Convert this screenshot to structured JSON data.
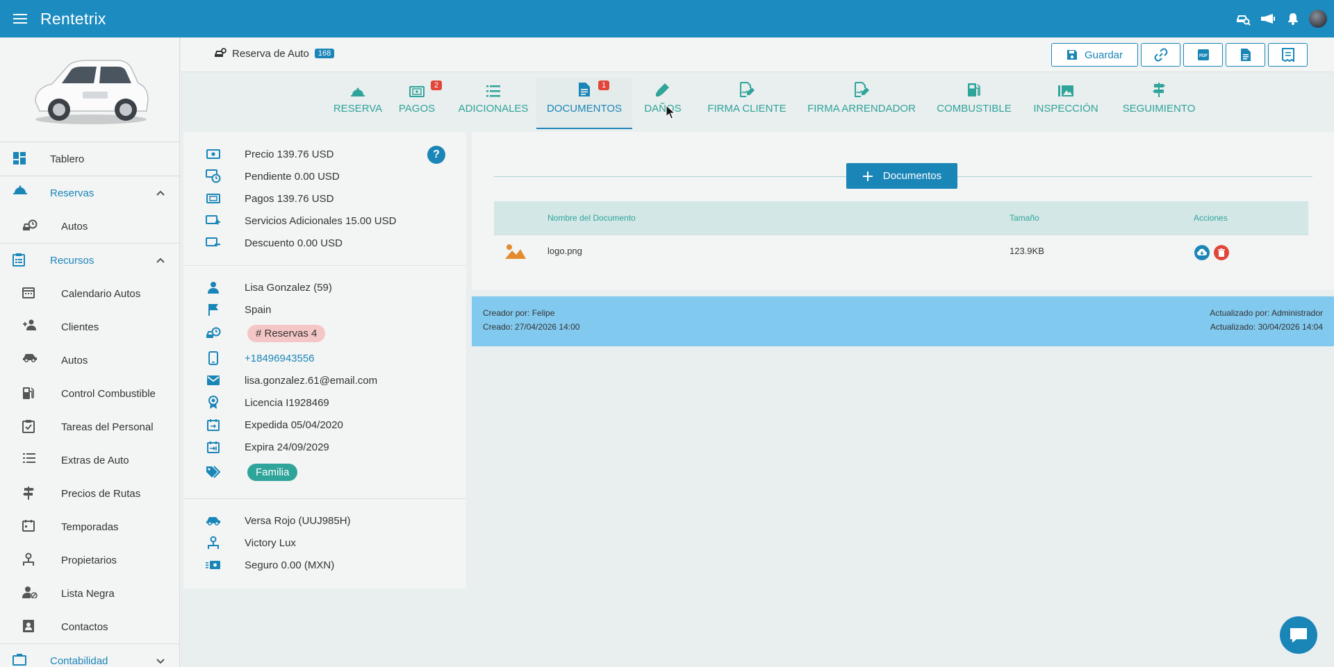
{
  "app": {
    "title": "Rentetrix"
  },
  "colors": {
    "primary": "#1a86b8",
    "topbar": "#1c8bc0",
    "teal": "#2fa49a",
    "badge_red": "#e0473a",
    "audit_bg": "#81c9ee"
  },
  "sidebar": {
    "items": [
      {
        "label": "Tablero",
        "icon": "dashboard-icon"
      },
      {
        "label": "Reservas",
        "icon": "reservations-icon",
        "section": true
      },
      {
        "label": "Autos",
        "icon": "car-clock-icon",
        "sub": true
      },
      {
        "label": "Recursos",
        "icon": "clipboard-icon",
        "section": true
      },
      {
        "label": "Calendario Autos",
        "icon": "calendar-icon",
        "sub": true
      },
      {
        "label": "Clientes",
        "icon": "person-add-icon",
        "sub": true
      },
      {
        "label": "Autos",
        "icon": "car-icon",
        "sub": true
      },
      {
        "label": "Control Combustible",
        "icon": "fuel-icon",
        "sub": true
      },
      {
        "label": "Tareas del Personal",
        "icon": "tasks-icon",
        "sub": true
      },
      {
        "label": "Extras de Auto",
        "icon": "list-icon",
        "sub": true
      },
      {
        "label": "Precios de Rutas",
        "icon": "signpost-icon",
        "sub": true
      },
      {
        "label": "Temporadas",
        "icon": "calendar-grid-icon",
        "sub": true
      },
      {
        "label": "Propietarios",
        "icon": "owner-icon",
        "sub": true
      },
      {
        "label": "Lista Negra",
        "icon": "person-block-icon",
        "sub": true
      },
      {
        "label": "Contactos",
        "icon": "contacts-icon",
        "sub": true
      },
      {
        "label": "Contabilidad",
        "icon": "accounting-icon",
        "section": true
      }
    ]
  },
  "header": {
    "title": "Reserva de Auto",
    "badge": "168",
    "save_label": "Guardar"
  },
  "tabs": [
    {
      "label": "RESERVA",
      "icon": "reservation-icon"
    },
    {
      "label": "PAGOS",
      "icon": "money-icon",
      "badge": "2"
    },
    {
      "label": "ADICIONALES",
      "icon": "list-icon"
    },
    {
      "label": "DOCUMENTOS",
      "icon": "document-icon",
      "badge": "1",
      "active": true
    },
    {
      "label": "DAÑOS",
      "icon": "brush-icon"
    },
    {
      "label": "FIRMA CLIENTE",
      "icon": "signature-icon"
    },
    {
      "label": "FIRMA ARRENDADOR",
      "icon": "signature-icon"
    },
    {
      "label": "COMBUSTIBLE",
      "icon": "fuel-icon"
    },
    {
      "label": "INSPECCIÓN",
      "icon": "gallery-icon"
    },
    {
      "label": "SEGUIMIENTO",
      "icon": "signpost-icon"
    }
  ],
  "summary": {
    "price": "Precio 139.76 USD",
    "pending": "Pendiente 0.00 USD",
    "payments": "Pagos 139.76 USD",
    "additional": "Servicios Adicionales 15.00 USD",
    "discount": "Descuento 0.00 USD",
    "help": "?"
  },
  "customer": {
    "name": "Lisa Gonzalez (59)",
    "country": "Spain",
    "reservations": "# Reservas 4",
    "phone": "+18496943556",
    "email": "lisa.gonzalez.61@email.com",
    "license": "Licencia I1928469",
    "issued": "Expedida 05/04/2020",
    "expires": "Expira 24/09/2029",
    "tag": "Familia"
  },
  "vehicle": {
    "model": "Versa Rojo (UUJ985H)",
    "owner": "Victory Lux",
    "insurance": "Seguro 0.00 (MXN)"
  },
  "documents": {
    "add_label": "Documentos",
    "columns": [
      "Nombre del Documento",
      "Tamaño",
      "Acciones"
    ],
    "rows": [
      {
        "name": "logo.png",
        "size": "123.9KB"
      }
    ]
  },
  "audit": {
    "created_by": "Creador por: Felipe",
    "created": "Creado: 27/04/2026 14:00",
    "updated_by": "Actualizado por: Administrador",
    "updated": "Actualizado: 30/04/2026 14:04"
  }
}
